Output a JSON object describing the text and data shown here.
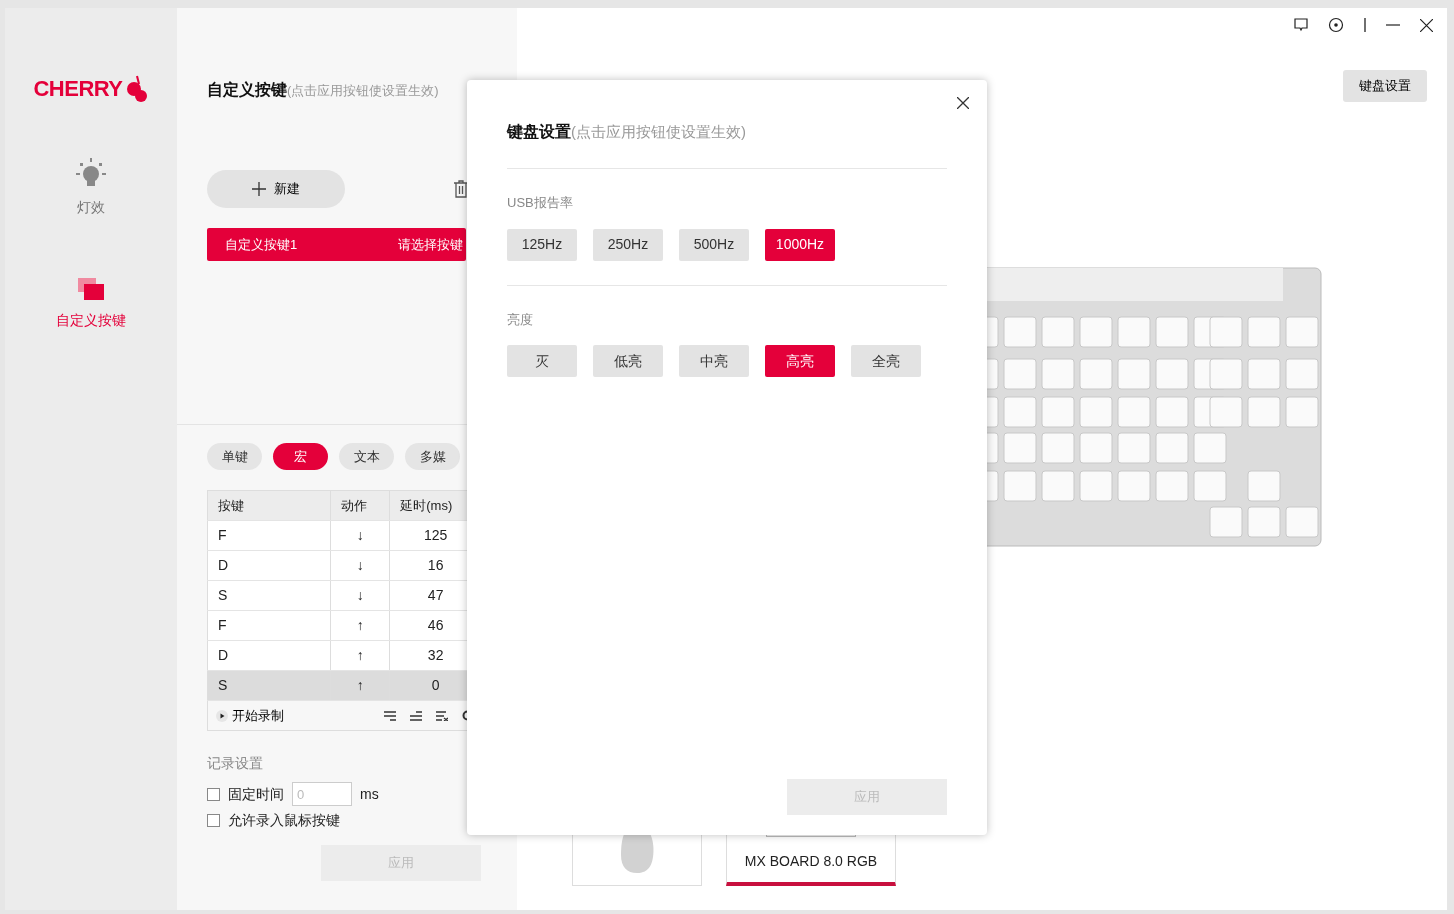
{
  "sidebar": {
    "logo": "CHERRY",
    "items": [
      {
        "kind": "lighting",
        "label": "灯效",
        "selected": false
      },
      {
        "kind": "keys",
        "label": "自定义按键",
        "selected": true
      }
    ]
  },
  "panel": {
    "title": "自定义按键",
    "hint": "(点击应用按钮使设置生效)",
    "new_button": "新建",
    "macros": [
      {
        "name": "自定义按键1",
        "key": "请选择按键",
        "selected": true
      }
    ],
    "modes": [
      {
        "label": "单键",
        "selected": false
      },
      {
        "label": "宏",
        "selected": true
      },
      {
        "label": "文本",
        "selected": false
      },
      {
        "label": "多媒",
        "selected": false
      }
    ],
    "table": {
      "columns": [
        "按键",
        "动作",
        "延时(ms)"
      ],
      "rows": [
        {
          "key": "F",
          "action": "↓",
          "delay": "125",
          "selected": false
        },
        {
          "key": "D",
          "action": "↓",
          "delay": "16",
          "selected": false
        },
        {
          "key": "S",
          "action": "↓",
          "delay": "47",
          "selected": false
        },
        {
          "key": "F",
          "action": "↑",
          "delay": "46",
          "selected": false
        },
        {
          "key": "D",
          "action": "↑",
          "delay": "32",
          "selected": false
        },
        {
          "key": "S",
          "action": "↑",
          "delay": "0",
          "selected": true
        }
      ],
      "record_button": "开始录制"
    },
    "record_settings": {
      "title": "记录设置",
      "fixed_time": {
        "label": "固定时间",
        "checked": false,
        "placeholder": "0",
        "unit": "ms"
      },
      "mouse_keys": {
        "label": "允许录入鼠标按键",
        "checked": false
      },
      "apply": {
        "label": "应用",
        "disabled": true
      }
    }
  },
  "main": {
    "settings_button": "键盘设置",
    "devices": [
      {
        "kind": "mouse",
        "selected": false
      },
      {
        "kind": "keyboard",
        "name": "MX BOARD 8.0 RGB",
        "selected": true
      }
    ]
  },
  "dialog": {
    "title": "键盘设置",
    "hint": "(点击应用按钮使设置生效)",
    "sections": [
      {
        "label": "USB报告率",
        "options": [
          {
            "label": "125Hz",
            "selected": false
          },
          {
            "label": "250Hz",
            "selected": false
          },
          {
            "label": "500Hz",
            "selected": false
          },
          {
            "label": "1000Hz",
            "selected": true
          }
        ]
      },
      {
        "label": "亮度",
        "options": [
          {
            "label": "灭",
            "selected": false
          },
          {
            "label": "低亮",
            "selected": false
          },
          {
            "label": "中亮",
            "selected": false
          },
          {
            "label": "高亮",
            "selected": true
          },
          {
            "label": "全亮",
            "selected": false
          }
        ]
      }
    ],
    "apply": {
      "label": "应用",
      "disabled": true
    }
  }
}
